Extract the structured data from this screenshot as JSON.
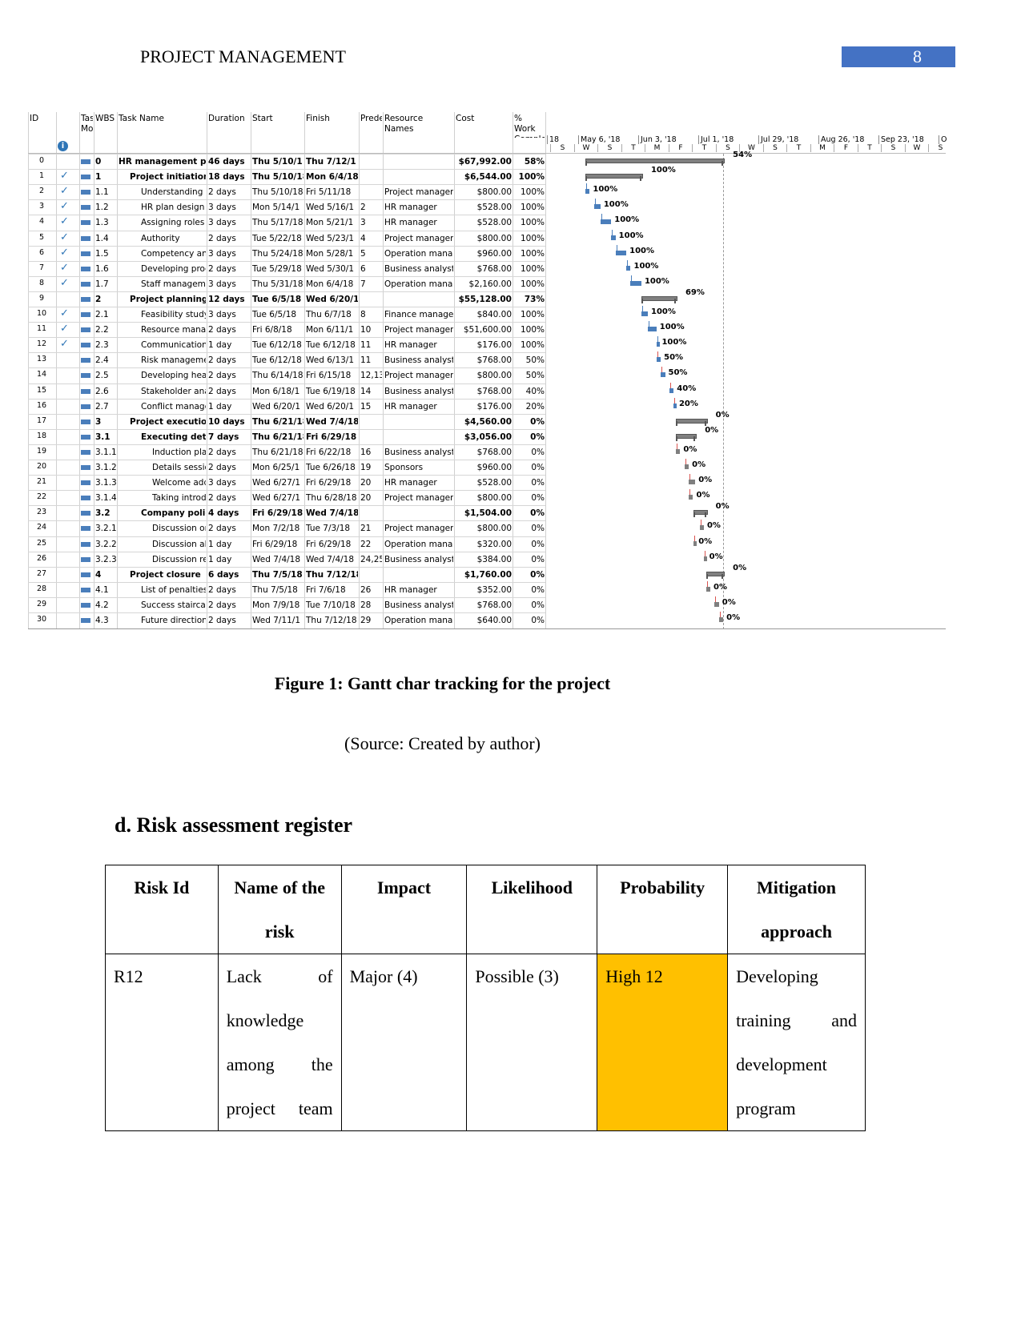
{
  "header": {
    "title": "PROJECT MANAGEMENT",
    "page_number": "8"
  },
  "gantt": {
    "columns": [
      "ID",
      "Tas Mo",
      "WBS",
      "Task Name",
      "Duration",
      "Start",
      "Finish",
      "Prede",
      "Resource Names",
      "Cost",
      "% Work Comple"
    ],
    "timescale": [
      "18",
      "May 6, '18",
      "Jun 3, '18",
      "Jul 1, '18",
      "Jul 29, '18",
      "Aug 26, '18",
      "Sep 23, '18",
      "O"
    ],
    "day_letters": [
      "S",
      "W",
      "S",
      "T",
      "M",
      "F",
      "T",
      "S",
      "W",
      "S",
      "T",
      "M",
      "F",
      "T",
      "S",
      "W",
      "S"
    ],
    "colors": {
      "complete": "#4a7ebb",
      "incomplete": "#d9534f",
      "summary": "#808080"
    },
    "tasks": [
      {
        "id": "0",
        "done": false,
        "wbs": "0",
        "name": "HR management plan",
        "dur": "46 days",
        "start": "Thu 5/10/1",
        "finish": "Thu 7/12/1",
        "pred": "",
        "res": "",
        "cost": "$67,992.00",
        "pct": "58%",
        "bold": true,
        "lvl": 0,
        "label": "54%",
        "bs": "2018-05-10",
        "be": "2018-07-12"
      },
      {
        "id": "1",
        "done": true,
        "wbs": "1",
        "name": "Project initiation",
        "dur": "18 days",
        "start": "Thu 5/10/18",
        "finish": "Mon 6/4/18",
        "pred": "",
        "res": "",
        "cost": "$6,544.00",
        "pct": "100%",
        "bold": true,
        "lvl": 1,
        "label": "100%",
        "bs": "2018-05-10",
        "be": "2018-06-04"
      },
      {
        "id": "2",
        "done": true,
        "wbs": "1.1",
        "name": "Understanding",
        "dur": "2 days",
        "start": "Thu 5/10/18",
        "finish": "Fri 5/11/18",
        "pred": "",
        "res": "Project manager",
        "cost": "$800.00",
        "pct": "100%",
        "bold": false,
        "lvl": 2,
        "label": "100%",
        "bs": "2018-05-10",
        "be": "2018-05-11"
      },
      {
        "id": "3",
        "done": true,
        "wbs": "1.2",
        "name": "HR plan design",
        "dur": "3 days",
        "start": "Mon 5/14/1",
        "finish": "Wed 5/16/1",
        "pred": "2",
        "res": "HR manager",
        "cost": "$528.00",
        "pct": "100%",
        "bold": false,
        "lvl": 2,
        "label": "100%",
        "bs": "2018-05-14",
        "be": "2018-05-16"
      },
      {
        "id": "4",
        "done": true,
        "wbs": "1.3",
        "name": "Assigning roles",
        "dur": "3 days",
        "start": "Thu 5/17/18",
        "finish": "Mon 5/21/1",
        "pred": "3",
        "res": "HR manager",
        "cost": "$528.00",
        "pct": "100%",
        "bold": false,
        "lvl": 2,
        "label": "100%",
        "bs": "2018-05-17",
        "be": "2018-05-21"
      },
      {
        "id": "5",
        "done": true,
        "wbs": "1.4",
        "name": "Authority",
        "dur": "2 days",
        "start": "Tue 5/22/18",
        "finish": "Wed 5/23/1",
        "pred": "4",
        "res": "Project manager",
        "cost": "$800.00",
        "pct": "100%",
        "bold": false,
        "lvl": 2,
        "label": "100%",
        "bs": "2018-05-22",
        "be": "2018-05-23"
      },
      {
        "id": "6",
        "done": true,
        "wbs": "1.5",
        "name": "Competency analysis",
        "dur": "3 days",
        "start": "Thu 5/24/18",
        "finish": "Mon 5/28/1",
        "pred": "5",
        "res": "Operation manager",
        "cost": "$960.00",
        "pct": "100%",
        "bold": false,
        "lvl": 2,
        "label": "100%",
        "bs": "2018-05-24",
        "be": "2018-05-28"
      },
      {
        "id": "7",
        "done": true,
        "wbs": "1.6",
        "name": "Developing process",
        "dur": "2 days",
        "start": "Tue 5/29/18",
        "finish": "Wed 5/30/1",
        "pred": "6",
        "res": "Business analyst",
        "cost": "$768.00",
        "pct": "100%",
        "bold": false,
        "lvl": 2,
        "label": "100%",
        "bs": "2018-05-29",
        "be": "2018-05-30"
      },
      {
        "id": "8",
        "done": true,
        "wbs": "1.7",
        "name": "Staff management",
        "dur": "3 days",
        "start": "Thu 5/31/18",
        "finish": "Mon 6/4/18",
        "pred": "7",
        "res": "Operation manager",
        "cost": "$2,160.00",
        "pct": "100%",
        "bold": false,
        "lvl": 2,
        "label": "100%",
        "bs": "2018-05-31",
        "be": "2018-06-04"
      },
      {
        "id": "9",
        "done": false,
        "wbs": "2",
        "name": "Project planning",
        "dur": "12 days",
        "start": "Tue 6/5/18",
        "finish": "Wed 6/20/1",
        "pred": "",
        "res": "",
        "cost": "$55,128.00",
        "pct": "73%",
        "bold": true,
        "lvl": 1,
        "label": "69%",
        "bs": "2018-06-05",
        "be": "2018-06-20"
      },
      {
        "id": "10",
        "done": true,
        "wbs": "2.1",
        "name": "Feasibility study",
        "dur": "3 days",
        "start": "Tue 6/5/18",
        "finish": "Thu 6/7/18",
        "pred": "8",
        "res": "Finance manager",
        "cost": "$840.00",
        "pct": "100%",
        "bold": false,
        "lvl": 2,
        "label": "100%",
        "bs": "2018-06-05",
        "be": "2018-06-07"
      },
      {
        "id": "11",
        "done": true,
        "wbs": "2.2",
        "name": "Resource management",
        "dur": "2 days",
        "start": "Fri 6/8/18",
        "finish": "Mon 6/11/1",
        "pred": "10",
        "res": "Project manager",
        "cost": "$51,600.00",
        "pct": "100%",
        "bold": false,
        "lvl": 2,
        "label": "100%",
        "bs": "2018-06-08",
        "be": "2018-06-11"
      },
      {
        "id": "12",
        "done": true,
        "wbs": "2.3",
        "name": "Communication",
        "dur": "1 day",
        "start": "Tue 6/12/18",
        "finish": "Tue 6/12/18",
        "pred": "11",
        "res": "HR manager",
        "cost": "$176.00",
        "pct": "100%",
        "bold": false,
        "lvl": 2,
        "label": "100%",
        "bs": "2018-06-12",
        "be": "2018-06-12"
      },
      {
        "id": "13",
        "done": false,
        "wbs": "2.4",
        "name": "Risk management",
        "dur": "2 days",
        "start": "Tue 6/12/18",
        "finish": "Wed 6/13/1",
        "pred": "11",
        "res": "Business analyst",
        "cost": "$768.00",
        "pct": "50%",
        "bold": false,
        "lvl": 2,
        "label": "50%",
        "bs": "2018-06-12",
        "be": "2018-06-13"
      },
      {
        "id": "14",
        "done": false,
        "wbs": "2.5",
        "name": "Developing health",
        "dur": "2 days",
        "start": "Thu 6/14/18",
        "finish": "Fri 6/15/18",
        "pred": "12,13",
        "res": "Project manager",
        "cost": "$800.00",
        "pct": "50%",
        "bold": false,
        "lvl": 2,
        "label": "50%",
        "bs": "2018-06-14",
        "be": "2018-06-15"
      },
      {
        "id": "15",
        "done": false,
        "wbs": "2.6",
        "name": "Stakeholder analysis",
        "dur": "2 days",
        "start": "Mon 6/18/1",
        "finish": "Tue 6/19/18",
        "pred": "14",
        "res": "Business analyst",
        "cost": "$768.00",
        "pct": "40%",
        "bold": false,
        "lvl": 2,
        "label": "40%",
        "bs": "2018-06-18",
        "be": "2018-06-19"
      },
      {
        "id": "16",
        "done": false,
        "wbs": "2.7",
        "name": "Conflict management",
        "dur": "1 day",
        "start": "Wed 6/20/1",
        "finish": "Wed 6/20/1",
        "pred": "15",
        "res": "HR manager",
        "cost": "$176.00",
        "pct": "20%",
        "bold": false,
        "lvl": 2,
        "label": "20%",
        "bs": "2018-06-20",
        "be": "2018-06-20"
      },
      {
        "id": "17",
        "done": false,
        "wbs": "3",
        "name": "Project execution",
        "dur": "10 days",
        "start": "Thu 6/21/18",
        "finish": "Wed 7/4/18",
        "pred": "",
        "res": "",
        "cost": "$4,560.00",
        "pct": "0%",
        "bold": true,
        "lvl": 1,
        "label": "0%",
        "bs": "2018-06-21",
        "be": "2018-07-04"
      },
      {
        "id": "18",
        "done": false,
        "wbs": "3.1",
        "name": "Executing details",
        "dur": "7 days",
        "start": "Thu 6/21/18",
        "finish": "Fri 6/29/18",
        "pred": "",
        "res": "",
        "cost": "$3,056.00",
        "pct": "0%",
        "bold": true,
        "lvl": 2,
        "label": "0%",
        "bs": "2018-06-21",
        "be": "2018-06-29"
      },
      {
        "id": "19",
        "done": false,
        "wbs": "3.1.1",
        "name": "Induction plan",
        "dur": "2 days",
        "start": "Thu 6/21/18",
        "finish": "Fri 6/22/18",
        "pred": "16",
        "res": "Business analyst",
        "cost": "$768.00",
        "pct": "0%",
        "bold": false,
        "lvl": 3,
        "label": "0%",
        "bs": "2018-06-21",
        "be": "2018-06-22"
      },
      {
        "id": "20",
        "done": false,
        "wbs": "3.1.2",
        "name": "Details session",
        "dur": "2 days",
        "start": "Mon 6/25/1",
        "finish": "Tue 6/26/18",
        "pred": "19",
        "res": "Sponsors",
        "cost": "$960.00",
        "pct": "0%",
        "bold": false,
        "lvl": 3,
        "label": "0%",
        "bs": "2018-06-25",
        "be": "2018-06-26"
      },
      {
        "id": "21",
        "done": false,
        "wbs": "3.1.3",
        "name": "Welcome address",
        "dur": "3 days",
        "start": "Wed 6/27/1",
        "finish": "Fri 6/29/18",
        "pred": "20",
        "res": "HR manager",
        "cost": "$528.00",
        "pct": "0%",
        "bold": false,
        "lvl": 3,
        "label": "0%",
        "bs": "2018-06-27",
        "be": "2018-06-29"
      },
      {
        "id": "22",
        "done": false,
        "wbs": "3.1.4",
        "name": "Taking introduction",
        "dur": "2 days",
        "start": "Wed 6/27/1",
        "finish": "Thu 6/28/18",
        "pred": "20",
        "res": "Project manager",
        "cost": "$800.00",
        "pct": "0%",
        "bold": false,
        "lvl": 3,
        "label": "0%",
        "bs": "2018-06-27",
        "be": "2018-06-28"
      },
      {
        "id": "23",
        "done": false,
        "wbs": "3.2",
        "name": "Company policies",
        "dur": "4 days",
        "start": "Fri 6/29/18",
        "finish": "Wed 7/4/18",
        "pred": "",
        "res": "",
        "cost": "$1,504.00",
        "pct": "0%",
        "bold": true,
        "lvl": 2,
        "label": "0%",
        "bs": "2018-06-29",
        "be": "2018-07-04"
      },
      {
        "id": "24",
        "done": false,
        "wbs": "3.2.1",
        "name": "Discussion on",
        "dur": "2 days",
        "start": "Mon 7/2/18",
        "finish": "Tue 7/3/18",
        "pred": "21",
        "res": "Project manager",
        "cost": "$800.00",
        "pct": "0%",
        "bold": false,
        "lvl": 3,
        "label": "0%",
        "bs": "2018-07-02",
        "be": "2018-07-03"
      },
      {
        "id": "25",
        "done": false,
        "wbs": "3.2.2",
        "name": "Discussion about",
        "dur": "1 day",
        "start": "Fri 6/29/18",
        "finish": "Fri 6/29/18",
        "pred": "22",
        "res": "Operation manager",
        "cost": "$320.00",
        "pct": "0%",
        "bold": false,
        "lvl": 3,
        "label": "0%",
        "bs": "2018-06-29",
        "be": "2018-06-29"
      },
      {
        "id": "26",
        "done": false,
        "wbs": "3.2.3",
        "name": "Discussion regarding",
        "dur": "1 day",
        "start": "Wed 7/4/18",
        "finish": "Wed 7/4/18",
        "pred": "24,25",
        "res": "Business analyst",
        "cost": "$384.00",
        "pct": "0%",
        "bold": false,
        "lvl": 3,
        "label": "0%",
        "bs": "2018-07-04",
        "be": "2018-07-04"
      },
      {
        "id": "27",
        "done": false,
        "wbs": "4",
        "name": "Project closure",
        "dur": "6 days",
        "start": "Thu 7/5/18",
        "finish": "Thu 7/12/18",
        "pred": "",
        "res": "",
        "cost": "$1,760.00",
        "pct": "0%",
        "bold": true,
        "lvl": 1,
        "label": "0%",
        "bs": "2018-07-05",
        "be": "2018-07-12"
      },
      {
        "id": "28",
        "done": false,
        "wbs": "4.1",
        "name": "List of penalties",
        "dur": "2 days",
        "start": "Thu 7/5/18",
        "finish": "Fri 7/6/18",
        "pred": "26",
        "res": "HR manager",
        "cost": "$352.00",
        "pct": "0%",
        "bold": false,
        "lvl": 2,
        "label": "0%",
        "bs": "2018-07-05",
        "be": "2018-07-06"
      },
      {
        "id": "29",
        "done": false,
        "wbs": "4.2",
        "name": "Success staircase",
        "dur": "2 days",
        "start": "Mon 7/9/18",
        "finish": "Tue 7/10/18",
        "pred": "28",
        "res": "Business analyst",
        "cost": "$768.00",
        "pct": "0%",
        "bold": false,
        "lvl": 2,
        "label": "0%",
        "bs": "2018-07-09",
        "be": "2018-07-10"
      },
      {
        "id": "30",
        "done": false,
        "wbs": "4.3",
        "name": "Future direction",
        "dur": "2 days",
        "start": "Wed 7/11/1",
        "finish": "Thu 7/12/18",
        "pred": "29",
        "res": "Operation manager",
        "cost": "$640.00",
        "pct": "0%",
        "bold": false,
        "lvl": 2,
        "label": "0%",
        "bs": "2018-07-11",
        "be": "2018-07-12"
      }
    ]
  },
  "figure": {
    "caption": "Figure 1: Gantt char tracking for the project",
    "source": "(Source: Created by author)"
  },
  "section": {
    "heading": "d. Risk assessment register"
  },
  "risk_table": {
    "headers": [
      "Risk Id",
      "Name of the risk",
      "Impact",
      "Likelihood",
      "Probability",
      "Mitigation approach"
    ],
    "rows": [
      {
        "id": "R12",
        "name": "Lack of knowledge among the project team",
        "impact": "Major (4)",
        "likelihood": "Possible (3)",
        "probability": "High 12",
        "mitigation": "Developing training and development program"
      }
    ],
    "highlight_color": "#ffc000"
  }
}
